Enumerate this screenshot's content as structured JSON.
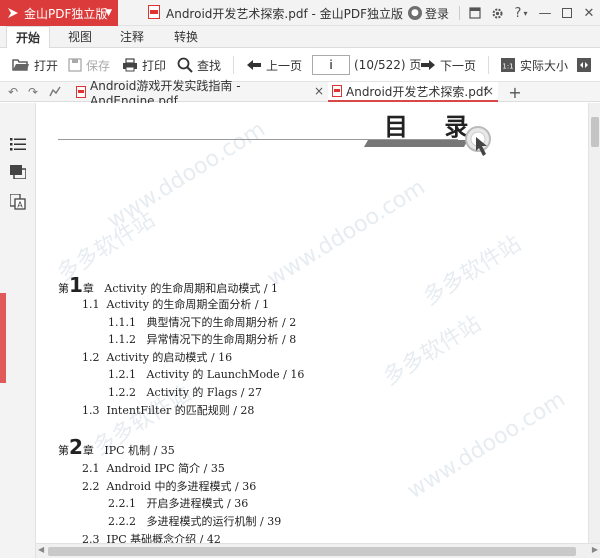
{
  "app": {
    "name": "金山PDF独立版",
    "window_title": "Android开发艺术探索.pdf - 金山PDF独立版",
    "login": "登录"
  },
  "menu": {
    "tabs": [
      "开始",
      "视图",
      "注释",
      "转换"
    ],
    "active": "开始"
  },
  "toolbar": {
    "open": "打开",
    "save": "保存",
    "print": "打印",
    "find": "查找",
    "prev": "上一页",
    "page_value": "i",
    "page_count": "(10/522) 页",
    "next": "下一页",
    "actual_size": "实际大小"
  },
  "doc_tabs": [
    {
      "label": "Android游戏开发实践指南 - AndEngine.pdf",
      "active": false
    },
    {
      "label": "Android开发艺术探索.pdf",
      "active": true
    }
  ],
  "page": {
    "heading": "目 录",
    "watermark_cn": "多多软件站",
    "watermark_url": "www.ddooo.com",
    "toc": [
      {
        "prefix": "第",
        "num": "1",
        "suffix": "章",
        "text": "Activity 的生命周期和启动模式 / 1"
      },
      {
        "num": "1.1",
        "text": "Activity 的生命周期全面分析 / 1"
      },
      {
        "num": "1.1.1",
        "text": "典型情况下的生命周期分析 / 2"
      },
      {
        "num": "1.1.2",
        "text": "异常情况下的生命周期分析 / 8"
      },
      {
        "num": "1.2",
        "text": "Activity 的启动模式 / 16"
      },
      {
        "num": "1.2.1",
        "text": "Activity 的 LaunchMode / 16"
      },
      {
        "num": "1.2.2",
        "text": "Activity 的 Flags / 27"
      },
      {
        "num": "1.3",
        "text": "IntentFilter 的匹配规则 / 28"
      },
      {
        "prefix": "第",
        "num": "2",
        "suffix": "章",
        "text": "IPC 机制 / 35"
      },
      {
        "num": "2.1",
        "text": "Android IPC 简介 / 35"
      },
      {
        "num": "2.2",
        "text": "Android 中的多进程模式 / 36"
      },
      {
        "num": "2.2.1",
        "text": "开启多进程模式 / 36"
      },
      {
        "num": "2.2.2",
        "text": "多进程模式的运行机制 / 39"
      },
      {
        "num": "2.3",
        "text": "IPC 基础概念介绍 / 42"
      }
    ]
  },
  "colors": {
    "accent": "#dc3b3b",
    "active_tab_line": "#d94848"
  }
}
